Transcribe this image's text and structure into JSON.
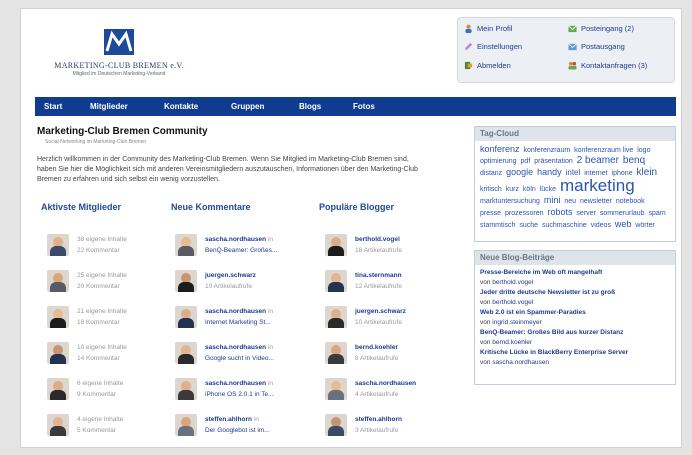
{
  "logo": {
    "name": "MARKETING-CLUB BREMEN e.V.",
    "subtitle": "Mitglied im Deutschen Marketing-Verband"
  },
  "user_menu": {
    "profile": "Mein Profil",
    "settings": "Einstellungen",
    "logout": "Abmelden",
    "inbox": "Posteingang (2)",
    "outbox": "Postausgang",
    "contact_requests": "Kontaktanfragen (3)"
  },
  "nav": [
    "Start",
    "Mitglieder",
    "Kontakte",
    "Gruppen",
    "Blogs",
    "Fotos"
  ],
  "main": {
    "title": "Marketing-Club Bremen Community",
    "subtitle": "Social-Networking im Marketing-Club Bremen",
    "intro": "Herzlich willkommen in der Community des Marketing-Club Bremen. Wenn Sie Mitglied im Marketing-Club Bremen sind, haben Sie hier die Möglichkeit sich mit anderen Vereinsmitgliedern auszutauschen, Informationen über den Marketing-Club Bremen zu erfahren und sich selbst ein wenig vorzustellen."
  },
  "active_members": {
    "heading": "Aktivste Mitglieder",
    "rows": [
      {
        "line1": "38 eigene Inhalte",
        "line2": "22 Kommentar"
      },
      {
        "line1": "25 eigene Inhalte",
        "line2": "20 Kommentar"
      },
      {
        "line1": "21 eigene Inhalte",
        "line2": "18 Kommentar"
      },
      {
        "line1": "10 eigene Inhalte",
        "line2": "14 Kommentar"
      },
      {
        "line1": "6 eigene Inhalte",
        "line2": "9 Kommentar"
      },
      {
        "line1": "4 eigene Inhalte",
        "line2": "5 Kommentar"
      }
    ]
  },
  "new_comments": {
    "heading": "Neue Kommentare",
    "in_word": "in",
    "rows": [
      {
        "user": "sascha.nordhausen",
        "target": "BenQ-Beamer: Großes..."
      },
      {
        "user": "juergen.schwarz",
        "target": "10 Artikelaufrufe"
      },
      {
        "user": "sascha.nordhausen",
        "target": "Internet Marketing St..."
      },
      {
        "user": "sascha.nordhausen",
        "target": "Google sucht in Video..."
      },
      {
        "user": "sascha.nordhausen",
        "target": "iPhone OS 2.0.1 in Te..."
      },
      {
        "user": "steffen.ahlhorn",
        "target": "Der Googlebot ist im..."
      }
    ]
  },
  "popular_bloggers": {
    "heading": "Populäre Blogger",
    "rows": [
      {
        "user": "berthold.vogel",
        "views": "18 Artikelaufrufe"
      },
      {
        "user": "tina.sternmann",
        "views": "12 Artikelaufrufe"
      },
      {
        "user": "juergen.schwarz",
        "views": "10 Artikelaufrufe"
      },
      {
        "user": "bernd.koehler",
        "views": "8 Artikelaufrufe"
      },
      {
        "user": "sascha.nordhausen",
        "views": "4 Artikelaufrufe"
      },
      {
        "user": "steffen.ahlhorn",
        "views": "3 Artikelaufrufe"
      }
    ]
  },
  "tag_cloud": {
    "heading": "Tag-Cloud",
    "tags": [
      {
        "t": "konferenz",
        "s": 9
      },
      {
        "t": "konferenzraum",
        "s": 7
      },
      {
        "t": "konferenzraum live",
        "s": 7
      },
      {
        "t": "logo",
        "s": 7
      },
      {
        "t": "optimierung",
        "s": 7
      },
      {
        "t": "pdf",
        "s": 7
      },
      {
        "t": "präsentation",
        "s": 7
      },
      {
        "t": "2 beamer",
        "s": 10
      },
      {
        "t": "benq",
        "s": 10
      },
      {
        "t": "distanz",
        "s": 7
      },
      {
        "t": "google",
        "s": 9
      },
      {
        "t": "handy",
        "s": 9
      },
      {
        "t": "intel",
        "s": 8
      },
      {
        "t": "internet",
        "s": 7
      },
      {
        "t": "iphone",
        "s": 7
      },
      {
        "t": "klein",
        "s": 10
      },
      {
        "t": "kritisch",
        "s": 7
      },
      {
        "t": "kurz",
        "s": 7
      },
      {
        "t": "köln",
        "s": 7
      },
      {
        "t": "lücke",
        "s": 7
      },
      {
        "t": "marketing",
        "s": 17
      },
      {
        "t": "marktuntersuchung",
        "s": 7
      },
      {
        "t": "mini",
        "s": 9
      },
      {
        "t": "neu",
        "s": 7
      },
      {
        "t": "newsletter",
        "s": 7
      },
      {
        "t": "notebook",
        "s": 7
      },
      {
        "t": "presse",
        "s": 7
      },
      {
        "t": "prozessoren",
        "s": 7
      },
      {
        "t": "robots",
        "s": 9
      },
      {
        "t": "server",
        "s": 7
      },
      {
        "t": "sommerurlaub",
        "s": 7
      },
      {
        "t": "spam",
        "s": 7
      },
      {
        "t": "stammtisch",
        "s": 7
      },
      {
        "t": "suche",
        "s": 7
      },
      {
        "t": "suchmaschine",
        "s": 7
      },
      {
        "t": "videos",
        "s": 7
      },
      {
        "t": "web",
        "s": 9
      },
      {
        "t": "wörter",
        "s": 7
      }
    ]
  },
  "blog_posts": {
    "heading": "Neue Blog-Beiträge",
    "by_word": "von",
    "posts": [
      {
        "title": "Presse-Bereiche im Web oft mangelhaft",
        "author": "berthold.vogel"
      },
      {
        "title": "Jeder dritte deutsche Newsletter ist zu groß",
        "author": "berthold.vogel"
      },
      {
        "title": "Web 2.0 ist ein Spammer-Paradies",
        "author": "ingrid.steinmeyer"
      },
      {
        "title": "BenQ-Beamer: Großes Bild aus kurzer Distanz",
        "author": "bernd.koehler"
      },
      {
        "title": "Kritische Lücke in BlackBerry Enterprise Server",
        "author": "sascha.nordhausen"
      }
    ]
  },
  "colors": {
    "nav_bg": "#0f3c8f",
    "link": "#1d3b8f",
    "heading": "#1f4a9a",
    "tag": "#2a55b0"
  }
}
